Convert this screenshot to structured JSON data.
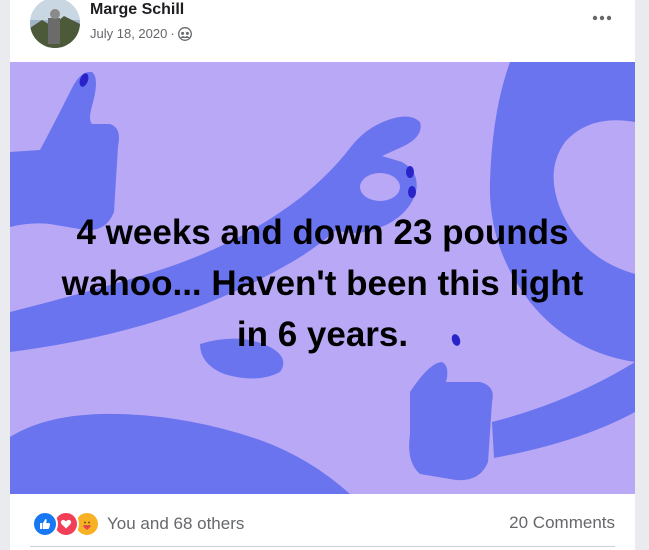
{
  "post": {
    "author": "Marge Schill",
    "date": "July 18, 2020",
    "separator": "·",
    "audience_icon": "friends-icon",
    "text": "4 weeks and down 23 pounds wahoo... Haven't been this light in 6 years."
  },
  "background": {
    "base_color": "#b9a8f5",
    "shape_color": "#6a74ee",
    "accent_color": "#2a23c9"
  },
  "reactions": {
    "icons": [
      "like-icon",
      "love-icon",
      "care-icon"
    ],
    "summary": "You and 68 others",
    "comments": "20 Comments"
  },
  "colors": {
    "like": "#1877f2",
    "love": "#f33e58",
    "care": "#f7b125",
    "secondary_text": "#65676b"
  }
}
